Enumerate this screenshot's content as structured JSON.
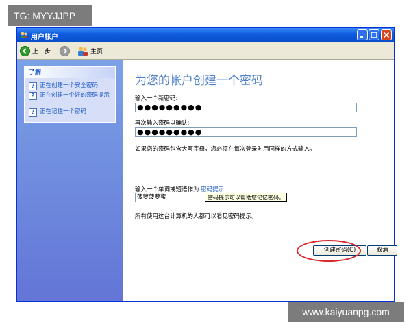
{
  "watermarks": {
    "top_left": "TG: MYYJJPP",
    "bottom_right": "www.kaiyuanpg.com"
  },
  "window": {
    "title": "用户帐户"
  },
  "toolbar": {
    "back_label": "上一步",
    "home_label": "主页"
  },
  "left_panel": {
    "header": "了解",
    "items": [
      {
        "label": "正在创建一个安全密码"
      },
      {
        "label": "正在创建一个好的密码提示"
      },
      {
        "label": "正在记住一个密码"
      }
    ]
  },
  "main": {
    "heading": "为您的帐户创建一个密码",
    "new_password_label": "输入一个新密码:",
    "new_password_value": "●●●●●●●●●",
    "confirm_password_label": "再次输入密码以确认:",
    "confirm_password_value": "●●●●●●●●●",
    "case_note": "如果您的密码包含大写字母，您必须在每次登录时用同样的方式输入。",
    "hint_prompt": "输入一个单词或短语作为",
    "hint_link": "密码提示:",
    "hint_value": "菠萝菠萝蜜",
    "tooltip": "密码提示可以帮助您记忆密码。",
    "visibility_note": "所有使用这台计算机的人都可以看见密码提示。",
    "create_button": "创建密码(C)",
    "cancel_button": "取消"
  },
  "colors": {
    "titlebar": "#0e5be0",
    "left_panel": "#6f8ede",
    "heading": "#4f7fc7",
    "link": "#215dc6",
    "highlight_ellipse": "#d7282e"
  }
}
